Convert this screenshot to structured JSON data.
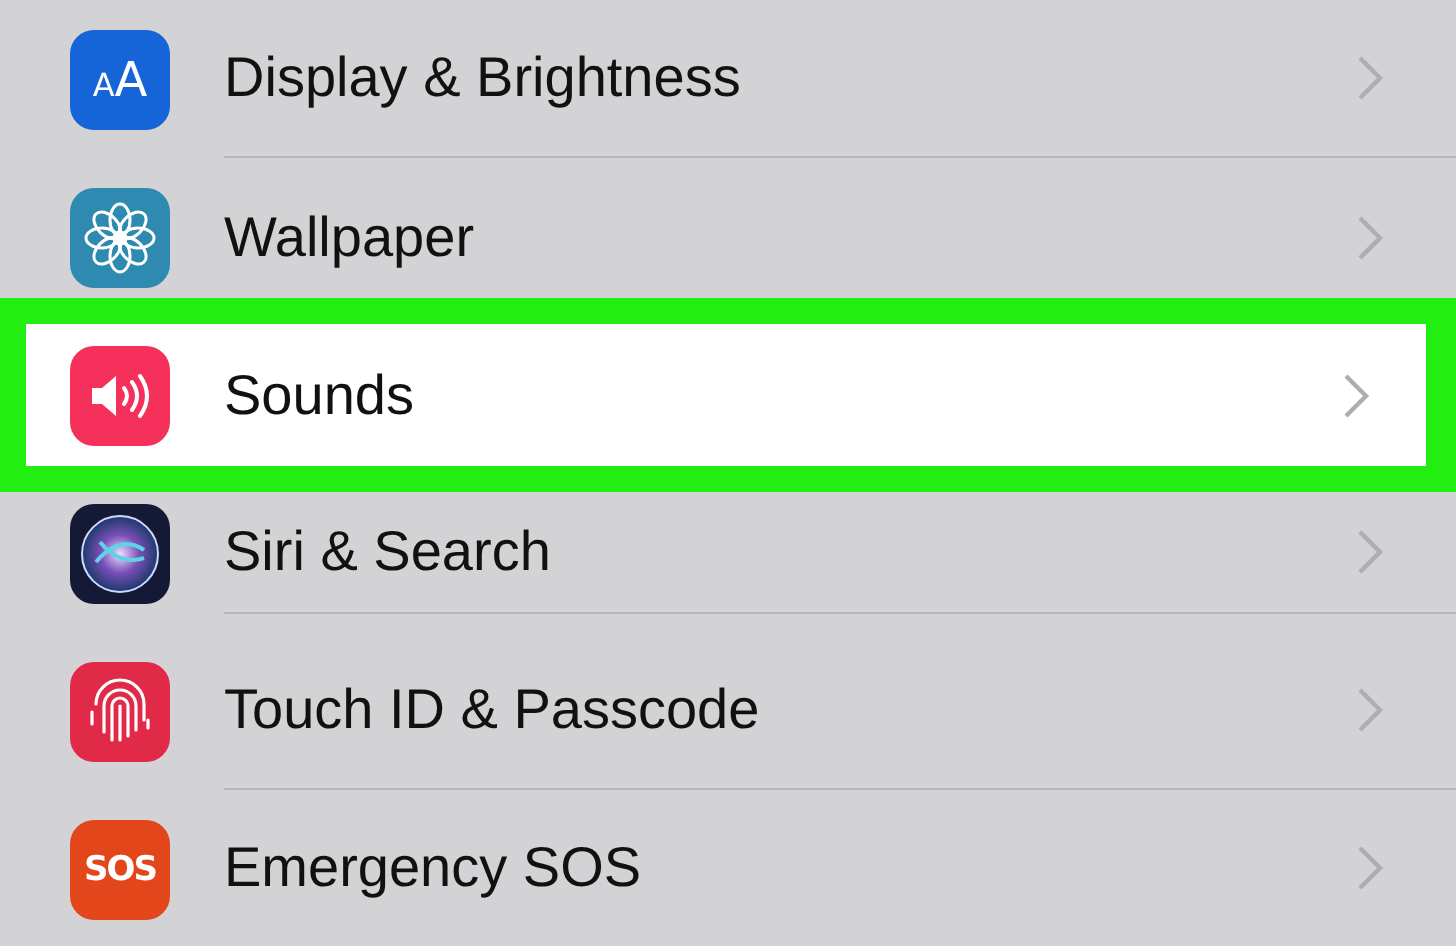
{
  "settings_list": [
    {
      "label": "Display & Brightness",
      "kind": "display",
      "icon_text": "AA",
      "selected": false
    },
    {
      "label": "Wallpaper",
      "kind": "wallpaper",
      "selected": false
    },
    {
      "label": "Sounds",
      "kind": "sounds",
      "selected": true
    },
    {
      "label": "Siri & Search",
      "kind": "siri",
      "selected": false
    },
    {
      "label": "Touch ID & Passcode",
      "kind": "touchid",
      "selected": false
    },
    {
      "label": "Emergency SOS",
      "kind": "sos",
      "icon_text": "SOS",
      "selected": false
    }
  ]
}
